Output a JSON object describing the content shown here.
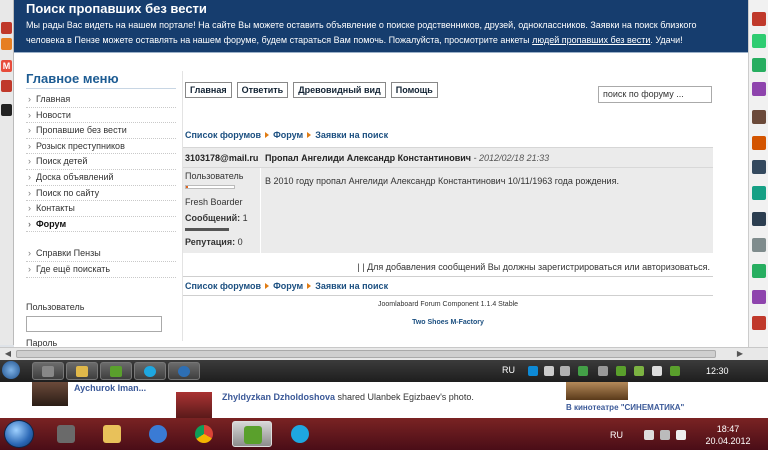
{
  "banner": {
    "title": "Поиск пропавших без вести",
    "text": "Мы рады Вас видеть на нашем портале! На сайте Вы можете оставить объявление о поиске родственников, друзей, одноклассников. Заявки на поиск близкого человека в Пензе можете оставлять на нашем форуме, будем стараться Вам помочь. Пожалуйста, просмотрите анкеты",
    "link": "людей пропавших без вести",
    "tail": ". Удачи!"
  },
  "menu": {
    "title": "Главное меню",
    "items": [
      {
        "label": "Главная"
      },
      {
        "label": "Новости"
      },
      {
        "label": "Пропавшие без вести"
      },
      {
        "label": "Розыск преступников"
      },
      {
        "label": "Поиск детей"
      },
      {
        "label": "Доска объявлений"
      },
      {
        "label": "Поиск по сайту"
      },
      {
        "label": "Контакты"
      },
      {
        "label": "Форум"
      }
    ],
    "items2": [
      {
        "label": "Справки Пензы"
      },
      {
        "label": "Где ещё поискать"
      }
    ],
    "login_user_label": "Пользователь",
    "login_pass_label": "Пароль"
  },
  "forum": {
    "toolbar": {
      "home": "Главная",
      "reply": "Ответить",
      "tree": "Древовидный вид",
      "help": "Помощь"
    },
    "search_placeholder": "поиск по форуму ...",
    "breadcrumb": [
      "Список форумов",
      "Форум",
      "Заявки на поиск"
    ],
    "post": {
      "author": "3103178@mail.ru",
      "subject": "Пропал Ангелиди Александр Константинович",
      "date": "- 2012/02/18 21:33",
      "role": "Пользователь",
      "rank_progress": 0.05,
      "rank": "Fresh Boarder",
      "messages_label": "Сообщений:",
      "messages_value": "1",
      "reputation_label": "Репутация:",
      "reputation_value": "0",
      "body": "В 2010 году пропал Ангелиди Александр Константинович 10/11/1963 года рождения."
    },
    "notice": "| | Для добавления сообщений Вы должны зарегистрироваться или авторизоваться.",
    "component": "Joomlaboard Forum Component 1.1.4 Stable",
    "credit": "Two Shoes M-Factory"
  },
  "remote_taskbar": {
    "lang": "RU",
    "clock": "12:30"
  },
  "background": {
    "name1": "Aychurok Iman...",
    "name2": "Zhyldyzkan Dzholdoshova",
    "action": " shared Ulanbek Egizbaev's photo.",
    "right_text": "В кинотеатре \"СИНЕМАТИКА\""
  },
  "taskbar": {
    "lang": "RU",
    "time": "18:47",
    "date": "20.04.2012"
  }
}
